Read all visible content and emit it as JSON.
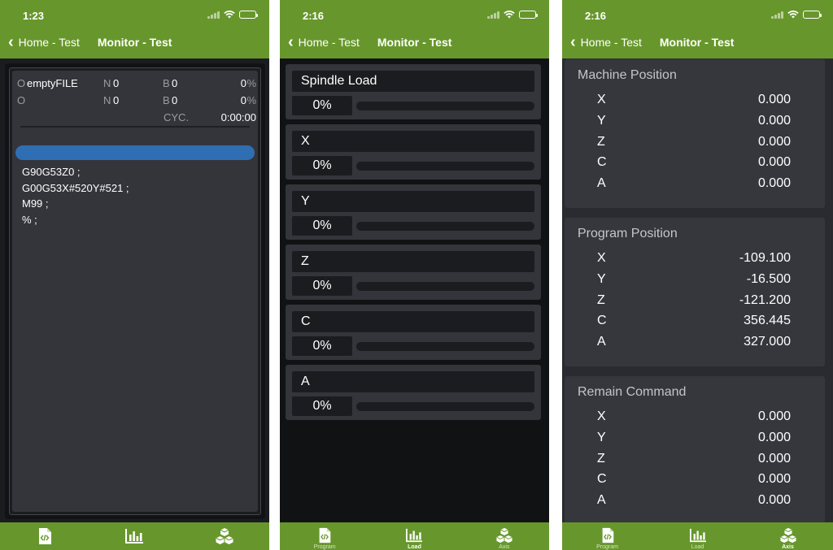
{
  "panels": [
    {
      "status_time": "1:23",
      "back_label": "Home - Test",
      "title": "Monitor - Test"
    },
    {
      "status_time": "2:16",
      "back_label": "Home - Test",
      "title": "Monitor - Test"
    },
    {
      "status_time": "2:16",
      "back_label": "Home - Test",
      "title": "Monitor - Test"
    }
  ],
  "tabs": [
    {
      "label": "Program",
      "icon": "program-code-icon"
    },
    {
      "label": "Load",
      "icon": "bar-chart-icon"
    },
    {
      "label": "Axis",
      "icon": "cubes-icon"
    }
  ],
  "program": {
    "row1": {
      "o_label": "O",
      "o_value": "emptyFILE",
      "n_label": "N",
      "n_value": "0",
      "b_label": "B",
      "b_value": "0",
      "pct_value": "0",
      "pct_unit": "%"
    },
    "row2": {
      "o_label": "O",
      "o_value": "",
      "n_label": "N",
      "n_value": "0",
      "b_label": "B",
      "b_value": "0",
      "pct_value": "0",
      "pct_unit": "%"
    },
    "cycle": {
      "label": "CYC.",
      "value": "0:00:00"
    },
    "lines": [
      "G90G53Z0 ;",
      "G00G53X#520Y#521 ;",
      "M99 ;",
      "% ;"
    ],
    "highlight_color": "#2f6eb3"
  },
  "load": [
    {
      "name": "Spindle Load",
      "percent_label": "0%",
      "level": 0
    },
    {
      "name": "X",
      "percent_label": "0%",
      "level": 0
    },
    {
      "name": "Y",
      "percent_label": "0%",
      "level": 0
    },
    {
      "name": "Z",
      "percent_label": "0%",
      "level": 0
    },
    {
      "name": "C",
      "percent_label": "0%",
      "level": 0
    },
    {
      "name": "A",
      "percent_label": "0%",
      "level": 0
    }
  ],
  "axis": {
    "machine": {
      "title": "Machine Position",
      "rows": [
        {
          "axis": "X",
          "value": "0.000"
        },
        {
          "axis": "Y",
          "value": "0.000"
        },
        {
          "axis": "Z",
          "value": "0.000"
        },
        {
          "axis": "C",
          "value": "0.000"
        },
        {
          "axis": "A",
          "value": "0.000"
        }
      ]
    },
    "program": {
      "title": "Program Position",
      "rows": [
        {
          "axis": "X",
          "value": "-109.100"
        },
        {
          "axis": "Y",
          "value": "-16.500"
        },
        {
          "axis": "Z",
          "value": "-121.200"
        },
        {
          "axis": "C",
          "value": "356.445"
        },
        {
          "axis": "A",
          "value": "327.000"
        }
      ]
    },
    "remain": {
      "title": "Remain Command",
      "rows": [
        {
          "axis": "X",
          "value": "0.000"
        },
        {
          "axis": "Y",
          "value": "0.000"
        },
        {
          "axis": "Z",
          "value": "0.000"
        },
        {
          "axis": "C",
          "value": "0.000"
        },
        {
          "axis": "A",
          "value": "0.000"
        }
      ]
    }
  },
  "colors": {
    "brand_green": "#67972c",
    "card": "#34353b",
    "dark": "#1b1c1f"
  }
}
